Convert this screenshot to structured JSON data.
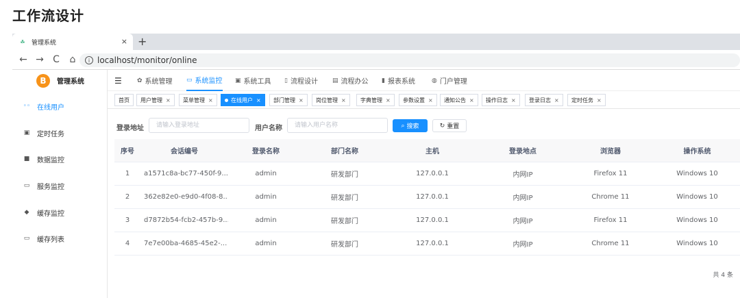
{
  "page_heading": "工作流设计",
  "browser": {
    "tab_title": "管理系统",
    "tab_close": "×",
    "new_tab": "+",
    "url": "localhost/monitor/online",
    "nav": {
      "back": "←",
      "forward": "→",
      "reload": "C",
      "home": "⌂"
    }
  },
  "app": {
    "logo_glyph": "B",
    "logo_text": "管理系统",
    "sidebar": {
      "items": [
        {
          "label": "在线用户",
          "icon": "users-icon",
          "glyph": "◦◦",
          "active": true
        },
        {
          "label": "定时任务",
          "icon": "job-icon",
          "glyph": "▣",
          "active": false
        },
        {
          "label": "数据监控",
          "icon": "database-icon",
          "glyph": "■",
          "active": false
        },
        {
          "label": "服务监控",
          "icon": "monitor-icon",
          "glyph": "▭",
          "active": false
        },
        {
          "label": "缓存监控",
          "icon": "redis-icon",
          "glyph": "◆",
          "active": false
        },
        {
          "label": "缓存列表",
          "icon": "list-icon",
          "glyph": "▭",
          "active": false
        }
      ]
    },
    "topnav": {
      "hamburger": "☰",
      "items": [
        {
          "label": "系统管理",
          "icon": "gear-icon",
          "glyph": "✿",
          "active": false
        },
        {
          "label": "系统监控",
          "icon": "monitor-icon",
          "glyph": "▭",
          "active": true
        },
        {
          "label": "系统工具",
          "icon": "toolbox-icon",
          "glyph": "▣",
          "active": false
        },
        {
          "label": "流程设计",
          "icon": "flow-icon",
          "glyph": "▯",
          "active": false
        },
        {
          "label": "流程办公",
          "icon": "office-icon",
          "glyph": "▤",
          "active": false
        },
        {
          "label": "报表系统",
          "icon": "chart-icon",
          "glyph": "▮",
          "active": false
        },
        {
          "label": "门户管理",
          "icon": "portal-icon",
          "glyph": "◍",
          "active": false
        }
      ]
    },
    "tags": [
      {
        "label": "首页",
        "closable": false,
        "active": false
      },
      {
        "label": "用户管理",
        "closable": true,
        "active": false
      },
      {
        "label": "菜单管理",
        "closable": true,
        "active": false
      },
      {
        "label": "在线用户",
        "closable": true,
        "active": true
      },
      {
        "label": "部门管理",
        "closable": true,
        "active": false
      },
      {
        "label": "岗位管理",
        "closable": true,
        "active": false
      },
      {
        "label": "字典管理",
        "closable": true,
        "active": false
      },
      {
        "label": "参数设置",
        "closable": true,
        "active": false
      },
      {
        "label": "通知公告",
        "closable": true,
        "active": false
      },
      {
        "label": "操作日志",
        "closable": true,
        "active": false
      },
      {
        "label": "登录日志",
        "closable": true,
        "active": false
      },
      {
        "label": "定时任务",
        "closable": true,
        "active": false
      }
    ],
    "tag_close": "×",
    "search": {
      "ip_label": "登录地址",
      "ip_placeholder": "请输入登录地址",
      "user_label": "用户名称",
      "user_placeholder": "请输入用户名称",
      "search_button": "搜索",
      "reset_button": "重置"
    },
    "table": {
      "headers": [
        "序号",
        "会话编号",
        "登录名称",
        "部门名称",
        "主机",
        "登录地点",
        "浏览器",
        "操作系统"
      ],
      "rows": [
        [
          "1",
          "a1571c8a-bc77-450f-9...",
          "admin",
          "研发部门",
          "127.0.0.1",
          "内网IP",
          "Firefox 11",
          "Windows 10"
        ],
        [
          "2",
          "362e82e0-e9d0-4f08-8...",
          "admin",
          "研发部门",
          "127.0.0.1",
          "内网IP",
          "Chrome 11",
          "Windows 10"
        ],
        [
          "3",
          "d7872b54-fcb2-457b-9...",
          "admin",
          "研发部门",
          "127.0.0.1",
          "内网IP",
          "Firefox 11",
          "Windows 10"
        ],
        [
          "4",
          "7e7e00ba-4685-45e2-...",
          "admin",
          "研发部门",
          "127.0.0.1",
          "内网IP",
          "Chrome 11",
          "Windows 10"
        ]
      ]
    },
    "pagination": {
      "total_text": "共 4 条"
    },
    "colors": {
      "primary": "#1890ff"
    }
  }
}
